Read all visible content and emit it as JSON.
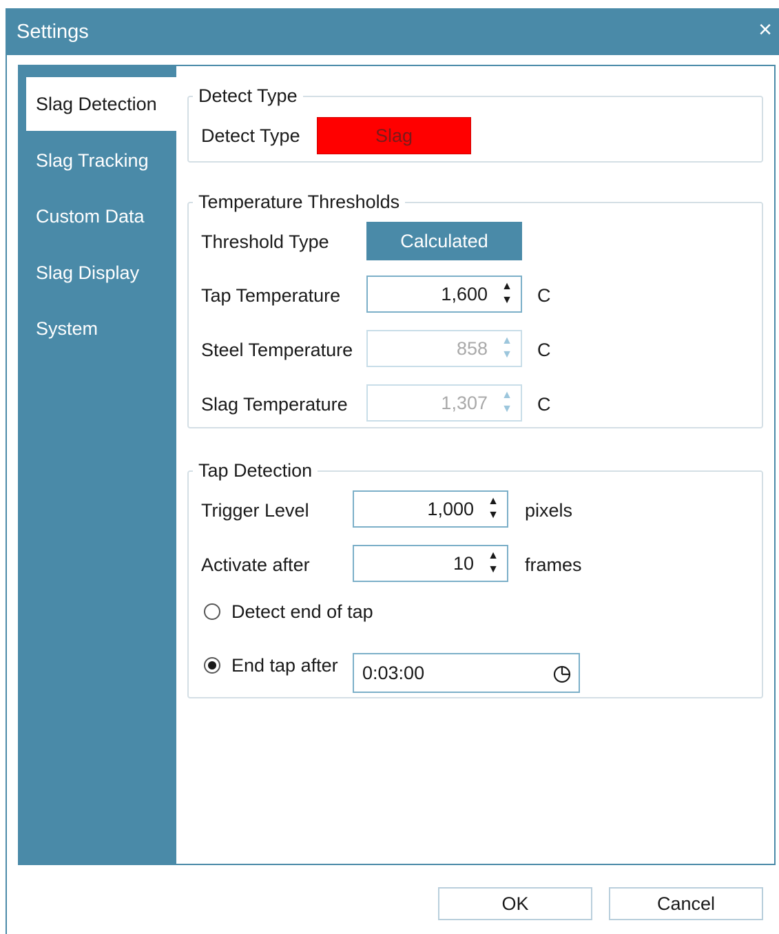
{
  "window": {
    "title": "Settings",
    "close_icon": "×"
  },
  "sidebar": {
    "items": [
      {
        "label": "Slag Detection",
        "active": true
      },
      {
        "label": "Slag Tracking"
      },
      {
        "label": "Custom Data"
      },
      {
        "label": "Slag Display"
      },
      {
        "label": "System"
      }
    ]
  },
  "detect_type": {
    "legend": "Detect Type",
    "label": "Detect Type",
    "button": "Slag",
    "button_color": "#ff0000"
  },
  "thresholds": {
    "legend": "Temperature Thresholds",
    "type_label": "Threshold Type",
    "type_button": "Calculated",
    "tap_label": "Tap Temperature",
    "tap_value": "1,600",
    "tap_unit": "C",
    "steel_label": "Steel Temperature",
    "steel_value": "858",
    "steel_unit": "C",
    "slag_label": "Slag Temperature",
    "slag_value": "1,307",
    "slag_unit": "C"
  },
  "tap_detection": {
    "legend": "Tap Detection",
    "trigger_label": "Trigger Level",
    "trigger_value": "1,000",
    "trigger_unit": "pixels",
    "activate_label": "Activate after",
    "activate_value": "10",
    "activate_unit": "frames",
    "detect_end_label": "Detect end of tap",
    "detect_end_checked": false,
    "end_after_label": "End tap after",
    "end_after_checked": true,
    "end_after_value": "0:03:00"
  },
  "footer": {
    "ok": "OK",
    "cancel": "Cancel"
  },
  "colors": {
    "accent": "#4a8aa8",
    "slag_button": "#ff0000"
  }
}
